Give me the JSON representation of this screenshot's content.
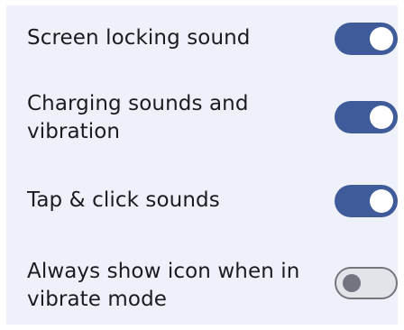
{
  "settings": {
    "items": [
      {
        "label": "Screen locking sound",
        "enabled": true
      },
      {
        "label": "Charging sounds and\nvibration",
        "enabled": true
      },
      {
        "label": "Tap & click sounds",
        "enabled": true
      },
      {
        "label": "Always show icon when in\nvibrate mode",
        "enabled": false
      }
    ]
  },
  "colors": {
    "panel_background": "#eef0fa",
    "toggle_on": "#3f5b9a",
    "toggle_off_track": "#e3e4ea",
    "toggle_off_knob": "#727480",
    "text": "#1c1c20"
  }
}
